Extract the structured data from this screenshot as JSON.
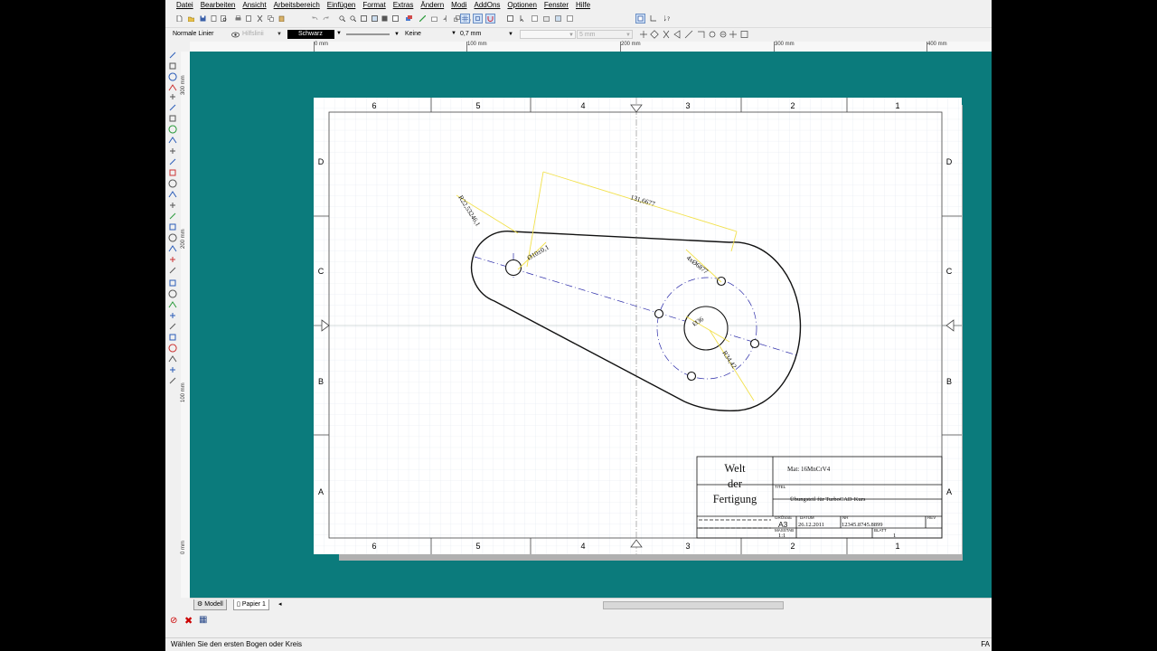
{
  "menu": [
    "Datei",
    "Bearbeiten",
    "Ansicht",
    "Arbeitsbereich",
    "Einfügen",
    "Format",
    "Extras",
    "Ändern",
    "Modi",
    "AddOns",
    "Optionen",
    "Fenster",
    "Hilfe"
  ],
  "props": {
    "line_style": "Normale Linier",
    "helper": "Hilfslinii",
    "color": "Schwarz",
    "pattern": "Keine",
    "width": "0,7 mm",
    "size": "5 mm"
  },
  "ruler": {
    "h": [
      "0 mm",
      "100 mm",
      "200 mm",
      "300 mm",
      "400 mm"
    ],
    "v": [
      "300 mm",
      "200 mm",
      "100 mm",
      "0 mm"
    ]
  },
  "drawing": {
    "zones_h": [
      "6",
      "5",
      "4",
      "3",
      "2",
      "1"
    ],
    "zones_v": [
      "D",
      "C",
      "B",
      "A"
    ],
    "dims": {
      "len": "131,6677",
      "radius_big": "R22,53246,1",
      "dia_small": "Ø10±0,1",
      "holes": "4xØ6877",
      "dia_center": "Ø36",
      "radius_pitch": "R34,42"
    },
    "title_block": {
      "company": [
        "Welt",
        "der",
        "Fertigung"
      ],
      "material": "Mat: 16MnCrV4",
      "title_label": "TITEL",
      "title": "Übungsteil für TurboCAD-Kurs",
      "size_label": "GRÖSSE",
      "size": "A3",
      "date_label": "DATUM",
      "date": "26.12.2011",
      "nr_label": "NR",
      "nr": "12345.8745.8899",
      "rev_label": "REV",
      "scale_label": "MASSTAB",
      "scale": "1:1",
      "sheet_label": "BLATT",
      "sheet": "1"
    }
  },
  "tabs": {
    "model": "Modell",
    "paper": "Papier 1"
  },
  "status": {
    "text": "Wählen Sie den ersten Bogen oder Kreis",
    "right": "FA"
  },
  "colors": {
    "canvas": "#0b7b7c",
    "dimension": "#f2e14c",
    "centerline": "#2a2aa8"
  }
}
